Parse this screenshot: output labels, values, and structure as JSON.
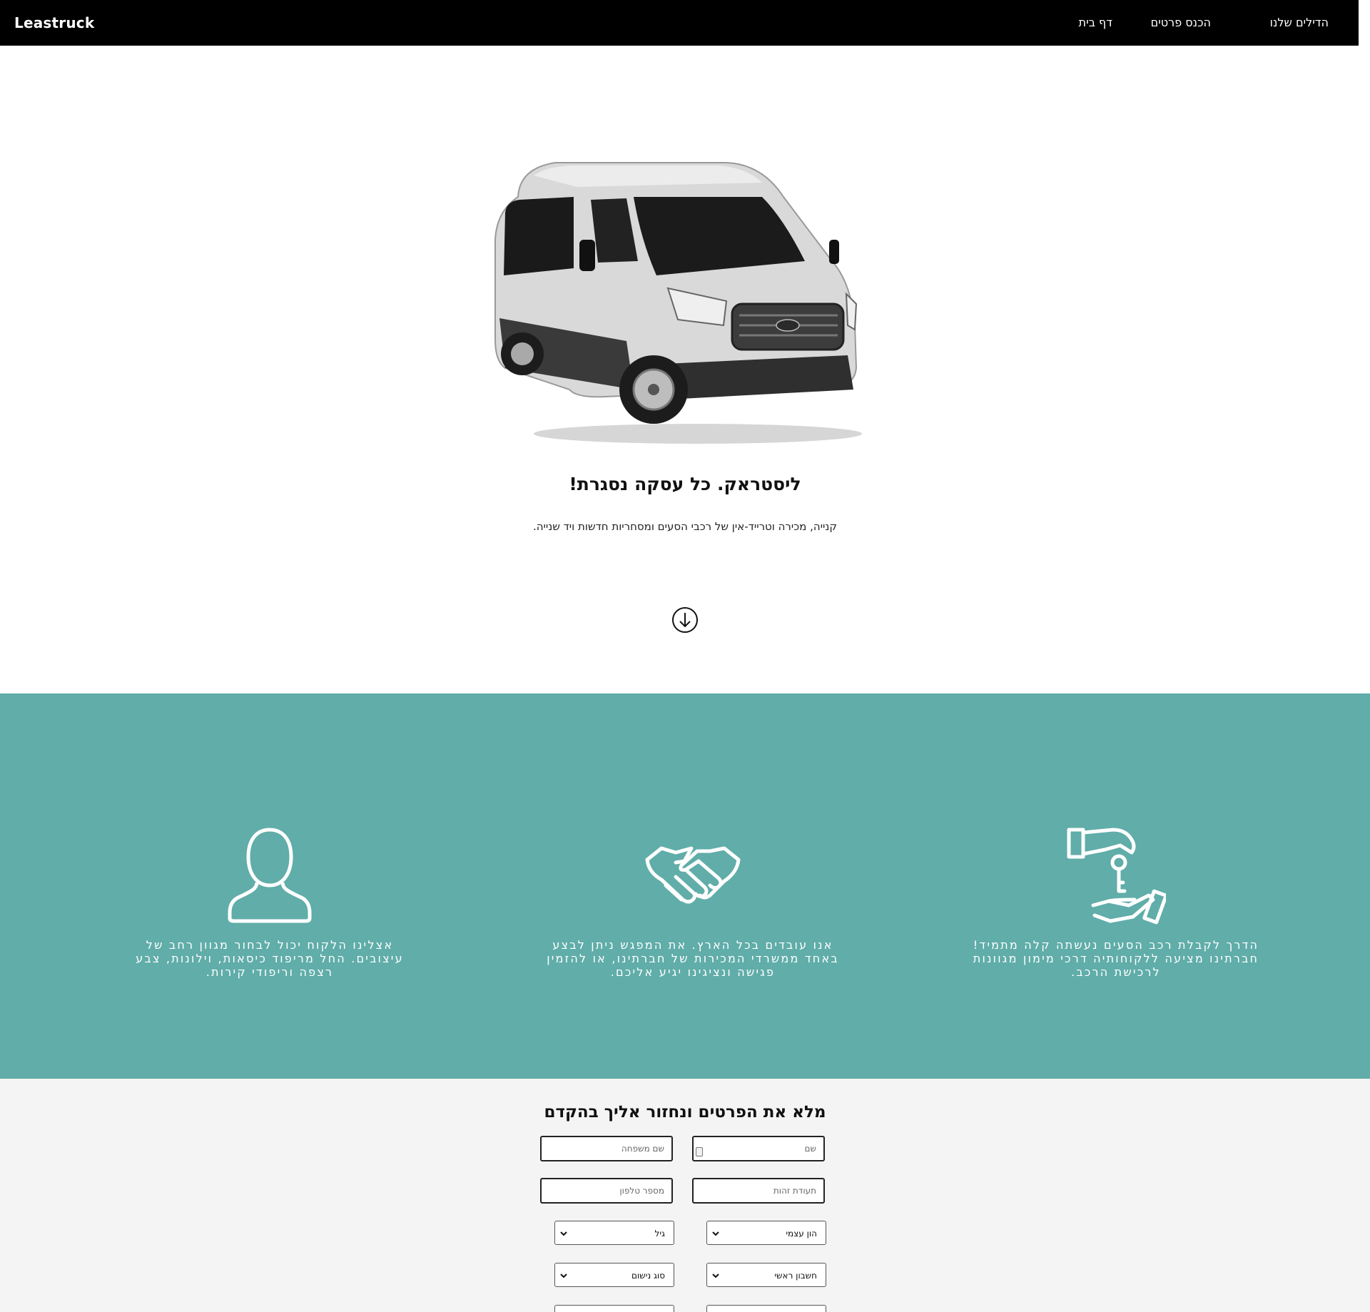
{
  "navbar": {
    "brand": "Leastruck",
    "links": [
      "הדילים שלנו",
      "הכנס פרטים",
      "דף בית"
    ]
  },
  "hero": {
    "image_alt": "white passenger van",
    "title": "ליסטראק. כל עסקה נסגרת!",
    "subtitle": "קנייה, מכירה וטרייד-אין של רכבי הסעים ומסחריות חדשות ויד שנייה.",
    "scroll_icon": "arrow-down-circle-icon"
  },
  "features": {
    "background": "#60ada9",
    "items": [
      {
        "icon": "person-icon",
        "text": "אצלינו הלקוח יכול לבחור מגוון רחב של עיצובים. החל מריפוד כיסאות, וילונות, צבע רצפה וריפודי קירות."
      },
      {
        "icon": "handshake-icon",
        "text": "אנו עובדים בכל הארץ. את המפגש ניתן לבצע באחד ממשרדי המכירות של חברתינו, או להזמין פגישה ונציגינו יגיע אליכם."
      },
      {
        "icon": "key-handover-icon",
        "text": "הדרך לקבלת רכב הסעים נעשתה קלה מתמיד! חברתינו מציעה ללקוחותיה דרכי מימון מגוונות לרכישת הרכב."
      }
    ]
  },
  "form": {
    "title": "מלא את הפרטים ונחזור אליך בהקדם",
    "first_name_placeholder": "שם",
    "last_name_placeholder": "שם משפחה",
    "id_placeholder": "תעודת זהות",
    "phone_placeholder": "מספר טלפון",
    "equity_select": "הון עצמי",
    "age_select": "גיל",
    "account_select": "חשבון ראשי",
    "transport_select": "סוג נישום"
  }
}
